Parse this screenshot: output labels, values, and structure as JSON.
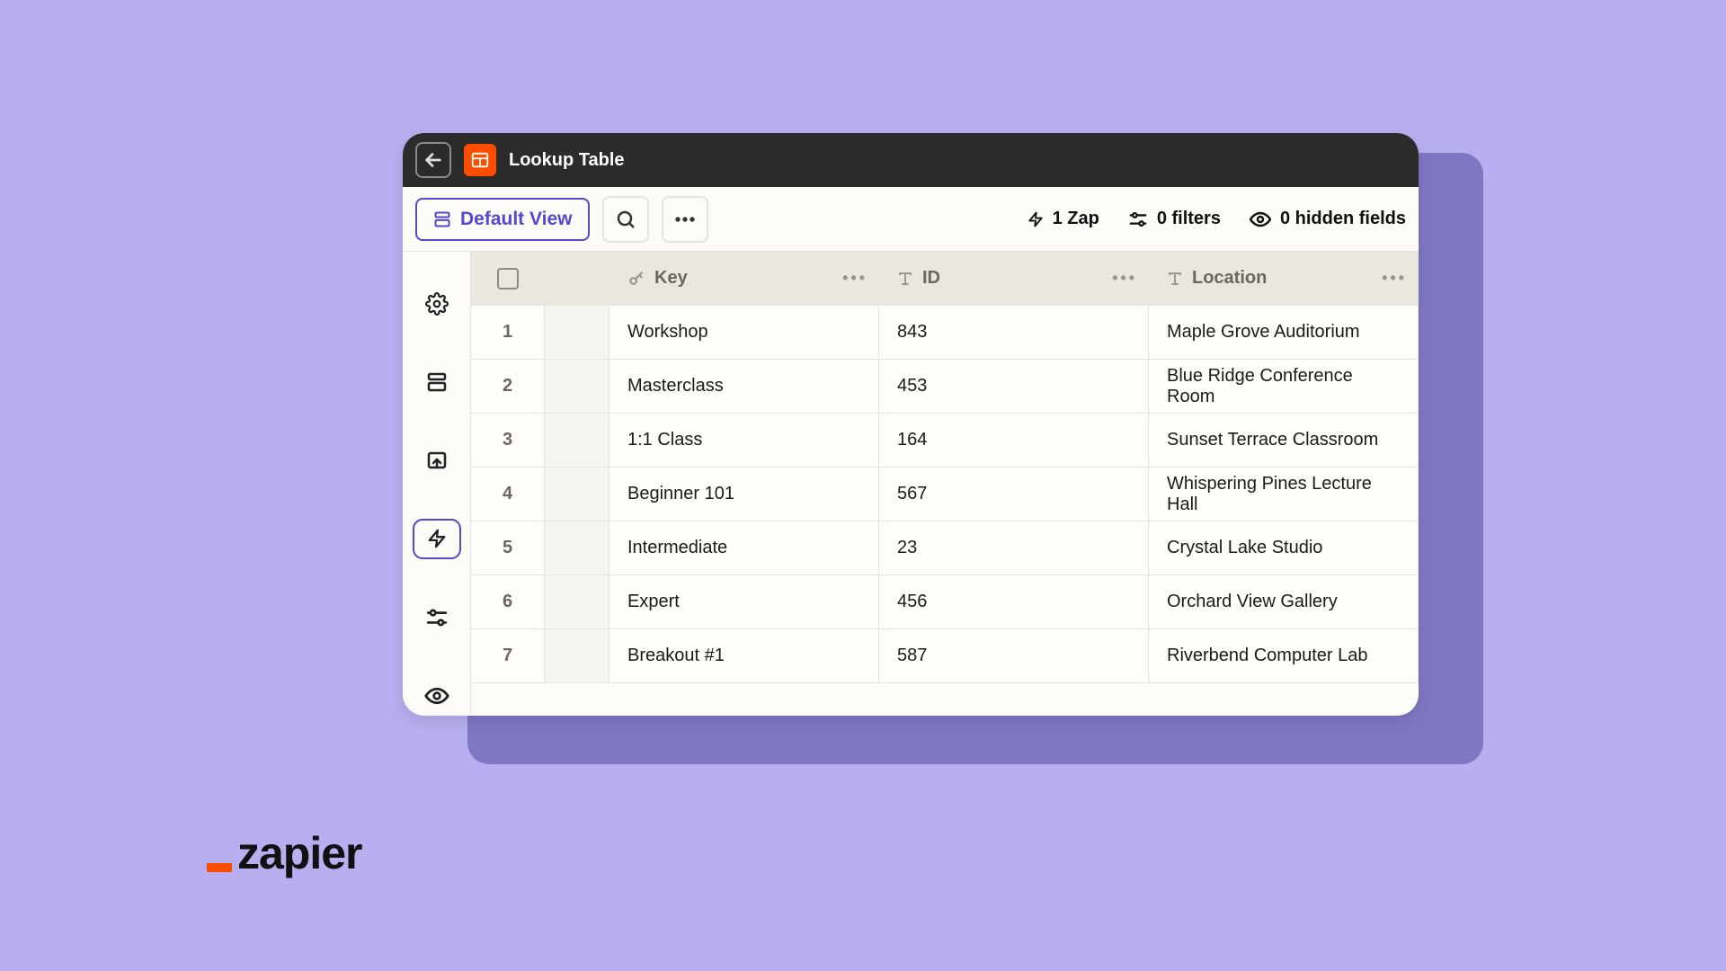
{
  "titlebar": {
    "title": "Lookup Table"
  },
  "toolbar": {
    "view_label": "Default View",
    "zap_meta": "1 Zap",
    "filters_meta": "0 filters",
    "hidden_fields_meta": "0 hidden fields"
  },
  "table": {
    "columns": [
      {
        "label": "Key",
        "icon": "key"
      },
      {
        "label": "ID",
        "icon": "text"
      },
      {
        "label": "Location",
        "icon": "text"
      }
    ],
    "rows": [
      {
        "n": "1",
        "key": "Workshop",
        "id": "843",
        "location": "Maple Grove Auditorium"
      },
      {
        "n": "2",
        "key": "Masterclass",
        "id": "453",
        "location": "Blue Ridge Conference Room"
      },
      {
        "n": "3",
        "key": "1:1 Class",
        "id": "164",
        "location": "Sunset Terrace Classroom"
      },
      {
        "n": "4",
        "key": "Beginner 101",
        "id": "567",
        "location": "Whispering Pines Lecture Hall"
      },
      {
        "n": "5",
        "key": "Intermediate",
        "id": "23",
        "location": "Crystal Lake Studio"
      },
      {
        "n": "6",
        "key": "Expert",
        "id": "456",
        "location": "Orchard View Gallery"
      },
      {
        "n": "7",
        "key": "Breakout #1",
        "id": "587",
        "location": "Riverbend Computer Lab"
      }
    ]
  },
  "brand": {
    "name": "zapier"
  }
}
